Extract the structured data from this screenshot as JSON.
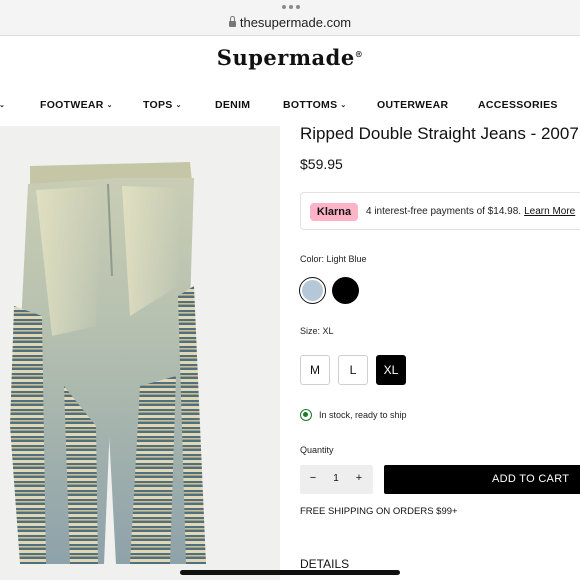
{
  "browser": {
    "url": "thesupermade.com"
  },
  "header": {
    "logo": "Supermade",
    "nav": [
      {
        "label": "FOOTWEAR",
        "dropdown": true
      },
      {
        "label": "TOPS",
        "dropdown": true
      },
      {
        "label": "DENIM",
        "dropdown": false
      },
      {
        "label": "BOTTOMS",
        "dropdown": true
      },
      {
        "label": "OUTERWEAR",
        "dropdown": false
      },
      {
        "label": "ACCESSORIES",
        "dropdown": false
      }
    ]
  },
  "product": {
    "title": "Ripped Double Straight Jeans - 2007",
    "price": "$59.95",
    "klarna": {
      "logo": "Klarna",
      "message": "4 interest-free payments of $14.98.",
      "link": "Learn More",
      "badge_color": "#ffb3c7"
    },
    "color": {
      "label": "Color: Light Blue",
      "swatches": [
        {
          "name": "Light Blue",
          "hex": "#b6c8d8",
          "selected": true
        },
        {
          "name": "Black",
          "hex": "#000000",
          "selected": false
        }
      ]
    },
    "size": {
      "label": "Size: XL",
      "options": [
        "M",
        "L",
        "XL"
      ],
      "selected": "XL"
    },
    "stock": {
      "text": "In stock, ready to ship",
      "color": "#1c7c2b"
    },
    "quantity": {
      "label": "Quantity",
      "value": "1",
      "minus": "−",
      "plus": "+"
    },
    "add_to_cart": "ADD TO CART",
    "shipping": "FREE SHIPPING ON ORDERS $99+",
    "details": "DETAILS"
  }
}
